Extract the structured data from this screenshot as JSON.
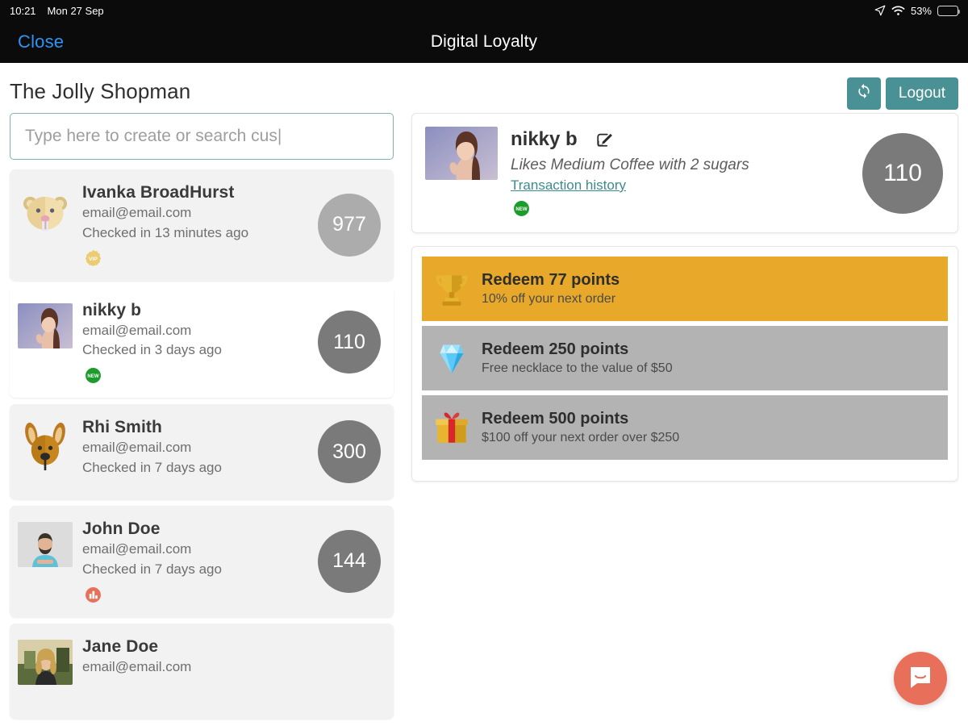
{
  "status_bar": {
    "time": "10:21",
    "date": "Mon 27 Sep",
    "battery_percent": "53%",
    "icons": [
      "location-arrow-icon",
      "wifi-icon",
      "battery-icon"
    ]
  },
  "title_bar": {
    "close_label": "Close",
    "app_title": "Digital Loyalty"
  },
  "header": {
    "shop_name": "The Jolly Shopman",
    "refresh_label": "⟳",
    "logout_label": "Logout"
  },
  "search": {
    "placeholder": "Type here to create or search cus|",
    "value": ""
  },
  "customers": [
    {
      "name": "Ivanka BroadHurst",
      "email": "email@email.com",
      "checkin": "Checked in 13 minutes ago",
      "points": "977",
      "badge": "vip-badge",
      "avatar": "hamster-avatar",
      "selected": false,
      "points_light": true
    },
    {
      "name": "nikky b",
      "email": "email@email.com",
      "checkin": "Checked in 3 days ago",
      "points": "110",
      "badge": "new-badge",
      "avatar": "photo-woman-avatar",
      "selected": true,
      "points_light": false
    },
    {
      "name": "Rhi Smith",
      "email": "email@email.com",
      "checkin": "Checked in 7 days ago",
      "points": "300",
      "badge": "",
      "avatar": "kangaroo-avatar",
      "selected": false,
      "points_light": false
    },
    {
      "name": "John Doe",
      "email": "email@email.com",
      "checkin": "Checked in 7 days ago",
      "points": "144",
      "badge": "chart-badge",
      "avatar": "photo-man-avatar",
      "selected": false,
      "points_light": false
    },
    {
      "name": "Jane Doe",
      "email": "email@email.com",
      "checkin": "",
      "points": "",
      "badge": "",
      "avatar": "photo-woman2-avatar",
      "selected": false,
      "points_light": false
    }
  ],
  "detail": {
    "name": "nikky b",
    "note": "Likes Medium Coffee with 2 sugars",
    "link_label": "Transaction history",
    "points": "110",
    "badge": "new-badge",
    "edit_icon": "edit-pencil-icon"
  },
  "rewards": [
    {
      "title": "Redeem 77 points",
      "subtitle": "10% off your next order",
      "icon": "trophy-icon",
      "active": true
    },
    {
      "title": "Redeem 250 points",
      "subtitle": "Free necklace to the value of $50",
      "icon": "diamond-icon",
      "active": false
    },
    {
      "title": "Redeem 500 points",
      "subtitle": "$100 off your next order over $250",
      "icon": "gift-icon",
      "active": false
    }
  ],
  "chat": {
    "icon": "chat-bubble-icon"
  },
  "colors": {
    "teal": "#4a9196",
    "amber": "#e8a92a",
    "gray_reward": "#b3b3b3",
    "points_gray": "#7a7a7a",
    "points_light_gray": "#acacac",
    "link_teal": "#3d8b91",
    "close_blue": "#2e94f5",
    "chat_coral": "#e8705a",
    "vip_gold": "#eccb72",
    "new_green": "#1c9c2b",
    "chart_badge_coral": "#e8705a"
  }
}
